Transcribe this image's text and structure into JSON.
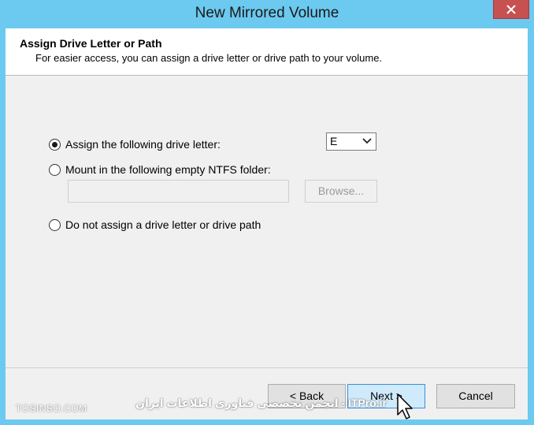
{
  "window": {
    "title": "New Mirrored Volume"
  },
  "header": {
    "title": "Assign Drive Letter or Path",
    "subtitle": "For easier access, you can assign a drive letter or drive path to your volume."
  },
  "options": {
    "assign_letter": {
      "label": "Assign the following drive letter:",
      "checked": true
    },
    "mount_folder": {
      "label": "Mount in the following empty NTFS folder:",
      "checked": false
    },
    "no_assign": {
      "label": "Do not assign a drive letter or drive path",
      "checked": false
    }
  },
  "drive_letter": {
    "value": "E"
  },
  "folder": {
    "value": "",
    "browse_label": "Browse..."
  },
  "buttons": {
    "back": "< Back",
    "next": "Next >",
    "cancel": "Cancel"
  },
  "watermark": {
    "left": "TOSINSO.COM",
    "right": "ITPro.ir - انجمن تخصصی فناوری اطلاعات ایران"
  },
  "colors": {
    "title_bar": "#6cc9ef",
    "close_button": "#c75050",
    "client_bg": "#f0f0f0",
    "default_button": "#cfeafb"
  }
}
